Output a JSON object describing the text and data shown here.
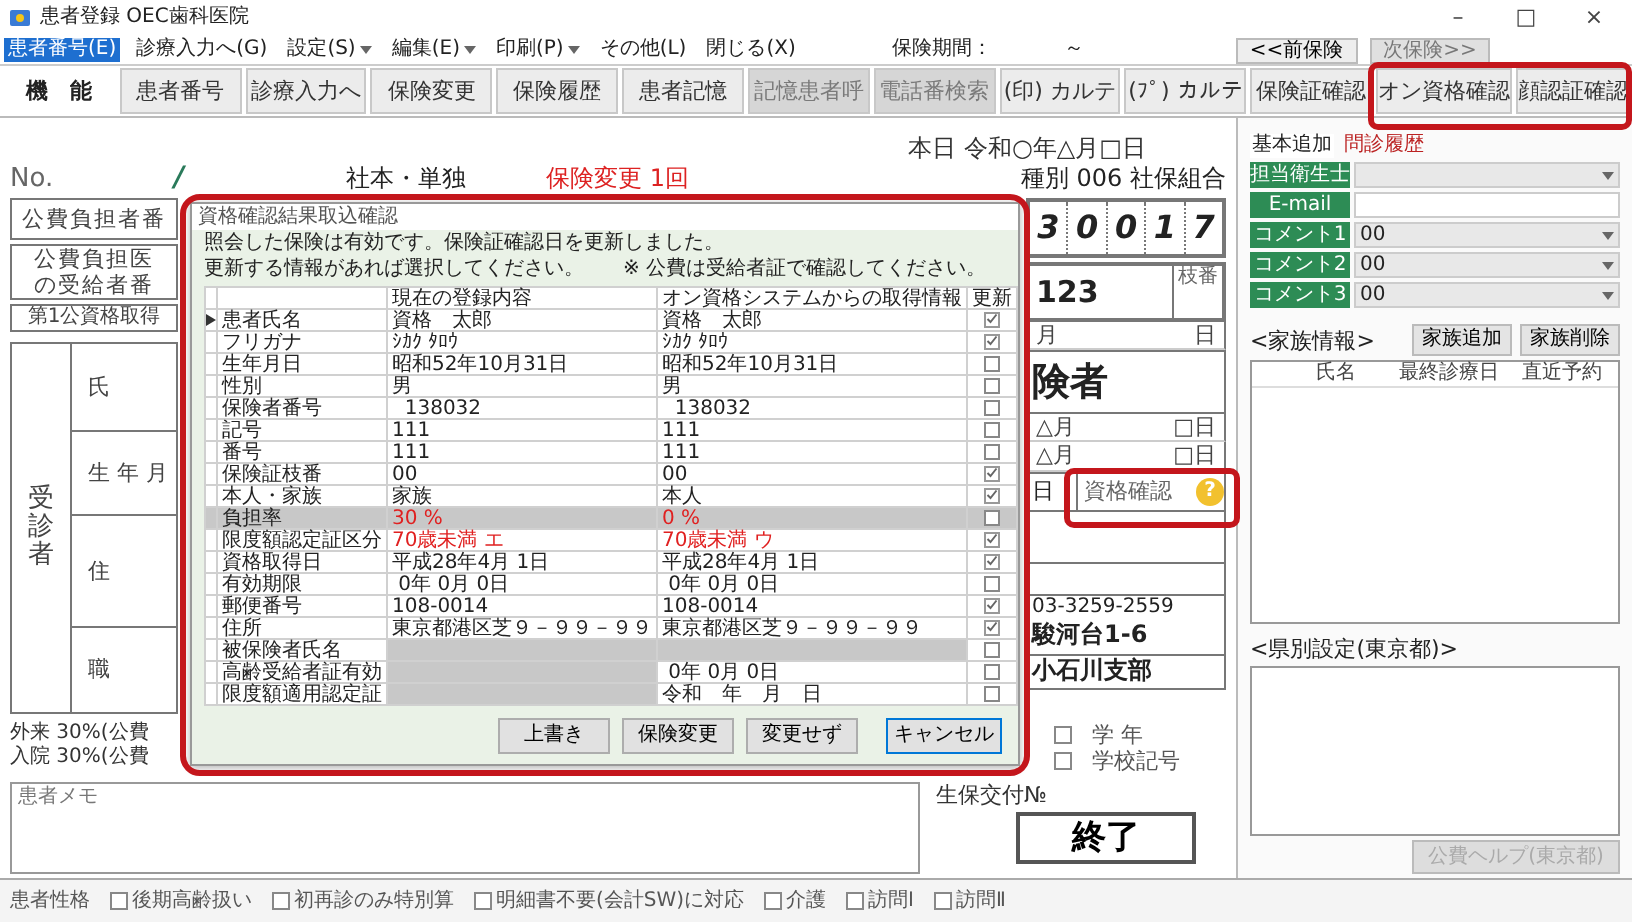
{
  "window": {
    "title": "患者登録 OEC歯科医院",
    "controls": [
      "–",
      "□",
      "×"
    ]
  },
  "menu": [
    {
      "label": "患者番号(E)",
      "selected": true,
      "dropdown": false
    },
    {
      "label": "診療入力へ(G)",
      "selected": false,
      "dropdown": false
    },
    {
      "label": "設定(S)",
      "selected": false,
      "dropdown": true
    },
    {
      "label": "編集(E)",
      "selected": false,
      "dropdown": true
    },
    {
      "label": "印刷(P)",
      "selected": false,
      "dropdown": true
    },
    {
      "label": "その他(L)",
      "selected": false,
      "dropdown": false
    },
    {
      "label": "閉じる(X)",
      "selected": false,
      "dropdown": false
    }
  ],
  "insurance_period": {
    "label": "保険期間：",
    "value": "～"
  },
  "nav_buttons": [
    {
      "label": "<<前保険",
      "disabled": false
    },
    {
      "label": "次保険>>",
      "disabled": true
    }
  ],
  "toolbar": [
    {
      "label": "機　能",
      "kind": "label",
      "disabled": false,
      "highlighted": false
    },
    {
      "label": "患者番号",
      "kind": "button",
      "disabled": false,
      "highlighted": false
    },
    {
      "label": "診療入力へ",
      "kind": "button",
      "disabled": false,
      "highlighted": false
    },
    {
      "label": "保険変更",
      "kind": "button",
      "disabled": false,
      "highlighted": false
    },
    {
      "label": "保険履歴",
      "kind": "button",
      "disabled": false,
      "highlighted": false
    },
    {
      "label": "患者記憶",
      "kind": "button",
      "disabled": false,
      "highlighted": false
    },
    {
      "label": "記憶患者呼",
      "kind": "button",
      "disabled": true,
      "highlighted": false
    },
    {
      "label": "電話番検索",
      "kind": "button",
      "disabled": true,
      "highlighted": false
    },
    {
      "label": "(印) カルテ",
      "kind": "button",
      "disabled": false,
      "highlighted": false
    },
    {
      "label": "(ﾌﾟ) カルテ",
      "kind": "button",
      "disabled": false,
      "highlighted": false
    },
    {
      "label": "保険証確認",
      "kind": "button",
      "disabled": false,
      "highlighted": false
    },
    {
      "label": "オン資格確認",
      "kind": "button",
      "disabled": false,
      "highlighted": true
    },
    {
      "label": "顔認証確認",
      "kind": "button",
      "disabled": false,
      "highlighted": true
    }
  ],
  "date": "本日 令和○年△月□日",
  "patient_line": {
    "no_label": "No.",
    "mark": "/",
    "type": "社本・単独",
    "change": "保険変更 1回",
    "category": "種別 006 社保組合"
  },
  "form_left": {
    "public_payer": "公費負担者番",
    "recipient": [
      "公費負担医",
      "の受給者番"
    ],
    "first_public": "第1公資格取得",
    "patient_vertical": "受診者",
    "fields": [
      "氏",
      "生 年 月",
      "住",
      "職"
    ],
    "ratios": [
      "外来 30%(公費",
      "入院 30%(公費"
    ],
    "memo_label": "患者メモ"
  },
  "form_right": {
    "insurer_digits": [
      "3",
      "0",
      "0",
      "1",
      "7"
    ],
    "number": "123",
    "branch_label": "枝番",
    "month_day": [
      "月",
      "日"
    ],
    "insured": "険者",
    "dates": [
      [
        "△月",
        "□日"
      ],
      [
        "△月",
        "□日"
      ]
    ],
    "day": "日",
    "qualification": {
      "label": "資格確認",
      "status": "?",
      "highlighted": true
    },
    "phone": "03-3259-2559",
    "address": "駿河台1-6",
    "branch_office": "小石川支部",
    "school_checks": [
      {
        "label": "学 年",
        "checked": false
      },
      {
        "label": "学校記号",
        "checked": false
      }
    ],
    "welfare_label": "生保交付№",
    "finish_button": "終了"
  },
  "side_tabs": [
    {
      "label": "基本追加",
      "selected": true
    },
    {
      "label": "問診履歴",
      "selected": false
    }
  ],
  "side_fields": [
    {
      "label": "担当衛生士",
      "kind": "select"
    },
    {
      "label": "E-mail",
      "kind": "text"
    },
    {
      "label": "コメント1",
      "kind": "select",
      "value": "00"
    },
    {
      "label": "コメント2",
      "kind": "select",
      "value": "00"
    },
    {
      "label": "コメント3",
      "kind": "select",
      "value": "00"
    }
  ],
  "family": {
    "title": "<家族情報>",
    "buttons": [
      "家族追加",
      "家族削除"
    ],
    "columns": [
      "氏名",
      "最終診療日",
      "直近予約"
    ]
  },
  "prefecture": {
    "title": "<県別設定(東京都)>",
    "button": {
      "label": "公費ヘルプ(東京都)",
      "disabled": true
    }
  },
  "dialog": {
    "title": "資格確認結果取込確認",
    "highlighted": true,
    "messages": [
      "照会した保険は有効です。保険証確認日を更新しました。",
      "更新する情報があれば選択してください。"
    ],
    "note": "※ 公費は受給者証で確認してください。",
    "columns": [
      "現在の登録内容",
      "オン資格システムからの取得情報",
      "更新"
    ],
    "rows": [
      {
        "label": "患者氏名",
        "current": "資格　太郎",
        "acquired": "資格　太郎",
        "update": true,
        "selected": true,
        "red": false,
        "kind": "plain"
      },
      {
        "label": "フリガナ",
        "current": "ｼｶｸ ﾀﾛｳ",
        "acquired": "ｼｶｸ ﾀﾛｳ",
        "update": true,
        "selected": false,
        "red": false,
        "kind": "plain"
      },
      {
        "label": "生年月日",
        "current": "昭和52年10月31日",
        "acquired": "昭和52年10月31日",
        "update": false,
        "selected": false,
        "red": false,
        "kind": "plain"
      },
      {
        "label": "性別",
        "current": "男",
        "acquired": "男",
        "update": false,
        "selected": false,
        "red": false,
        "kind": "plain"
      },
      {
        "label": "保険者番号",
        "current": "  138032",
        "acquired": "  138032",
        "update": false,
        "selected": false,
        "red": false,
        "kind": "plain"
      },
      {
        "label": "記号",
        "current": "111",
        "acquired": "111",
        "update": false,
        "selected": false,
        "red": false,
        "kind": "plain"
      },
      {
        "label": "番号",
        "current": "111",
        "acquired": "111",
        "update": false,
        "selected": false,
        "red": false,
        "kind": "plain"
      },
      {
        "label": "保険証枝番",
        "current": "00",
        "acquired": "00",
        "update": true,
        "selected": false,
        "red": false,
        "kind": "plain"
      },
      {
        "label": "本人・家族",
        "current": "家族",
        "acquired": "本人",
        "update": true,
        "selected": false,
        "red": false,
        "kind": "plain"
      },
      {
        "label": "負担率",
        "current": "30 %",
        "acquired": "0 %",
        "update": false,
        "selected": false,
        "red": true,
        "kind": "shaded"
      },
      {
        "label": "限度額認定証区分",
        "current": "70歳未満 エ",
        "acquired": "70歳未満 ウ",
        "update": true,
        "selected": false,
        "red": true,
        "kind": "plain"
      },
      {
        "label": "資格取得日",
        "current": "平成28年4月 1日",
        "acquired": "平成28年4月 1日",
        "update": true,
        "selected": false,
        "red": false,
        "kind": "plain"
      },
      {
        "label": "有効期限",
        "current": " 0年 0月 0日",
        "acquired": " 0年 0月 0日",
        "update": false,
        "selected": false,
        "red": false,
        "kind": "plain"
      },
      {
        "label": "郵便番号",
        "current": "108-0014",
        "acquired": "108-0014",
        "update": true,
        "selected": false,
        "red": false,
        "kind": "plain"
      },
      {
        "label": "住所",
        "current": "東京都港区芝９－９９－９９",
        "acquired": "東京都港区芝９－９９－９９",
        "update": true,
        "selected": false,
        "red": false,
        "kind": "plain"
      },
      {
        "label": "被保険者氏名",
        "update": false,
        "selected": false,
        "kind": "void"
      },
      {
        "label": "高齢受給者証有効",
        "acquired": " 0年 0月 0日",
        "update": false,
        "selected": false,
        "red": false,
        "kind": "partial"
      },
      {
        "label": "限度額適用認定証",
        "acquired": "令和　年　月　日",
        "update": false,
        "selected": false,
        "red": false,
        "kind": "partial"
      }
    ],
    "buttons": [
      {
        "label": "上書き",
        "default": false
      },
      {
        "label": "保険変更",
        "default": false
      },
      {
        "label": "変更せず",
        "default": false
      },
      {
        "label": "キャンセル",
        "default": true
      }
    ]
  },
  "status_bar": {
    "label": "患者性格",
    "options": [
      {
        "label": "後期高齢扱い",
        "checked": false
      },
      {
        "label": "初再診のみ特別算",
        "checked": false
      },
      {
        "label": "明細書不要(会計SW)に対応",
        "checked": false
      },
      {
        "label": "介護",
        "checked": false
      },
      {
        "label": "訪問Ⅰ",
        "checked": false
      },
      {
        "label": "訪問Ⅱ",
        "checked": false
      }
    ]
  }
}
